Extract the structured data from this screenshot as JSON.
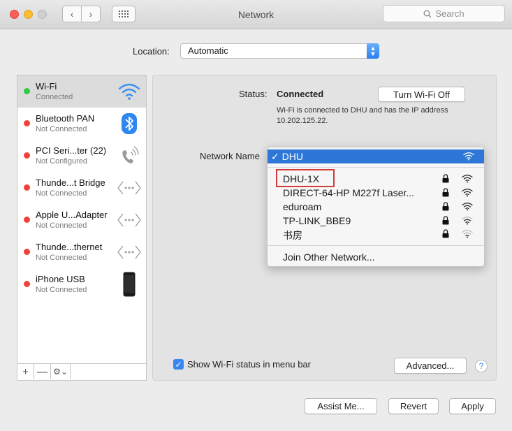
{
  "window": {
    "title": "Network"
  },
  "search": {
    "placeholder": "Search"
  },
  "location": {
    "label": "Location:",
    "value": "Automatic"
  },
  "services": [
    {
      "name": "Wi-Fi",
      "status": "Connected",
      "dot": "#2ecc40",
      "icon": "wifi-icon"
    },
    {
      "name": "Bluetooth PAN",
      "status": "Not Connected",
      "dot": "#f0413a",
      "icon": "bluetooth-icon"
    },
    {
      "name": "PCI Seri...ter (22)",
      "status": "Not Configured",
      "dot": "#f0413a",
      "icon": "phone-icon"
    },
    {
      "name": "Thunde...t Bridge",
      "status": "Not Connected",
      "dot": "#f0413a",
      "icon": "ethernet-icon"
    },
    {
      "name": "Apple U...Adapter",
      "status": "Not Connected",
      "dot": "#f0413a",
      "icon": "ethernet-icon"
    },
    {
      "name": "Thunde...thernet",
      "status": "Not Connected",
      "dot": "#f0413a",
      "icon": "ethernet-icon"
    },
    {
      "name": "iPhone USB",
      "status": "Not Connected",
      "dot": "#f0413a",
      "icon": "iphone-icon"
    }
  ],
  "sidebar_tools": {
    "add": "+",
    "remove": "—",
    "gear": "⚙︎⌄"
  },
  "status": {
    "label": "Status:",
    "value": "Connected",
    "toggle_button": "Turn Wi-Fi Off",
    "description": "Wi-Fi is connected to DHU and has the IP address 10.202.125.22."
  },
  "network_name": {
    "label": "Network Name"
  },
  "dropdown": {
    "selected": "DHU",
    "networks": [
      {
        "name": "DHU-1X"
      },
      {
        "name": "DIRECT-64-HP M227f Laser..."
      },
      {
        "name": "eduroam"
      },
      {
        "name": "TP-LINK_BBE9"
      },
      {
        "name": "书房"
      }
    ],
    "join_other": "Join Other Network..."
  },
  "show_status": {
    "label": "Show Wi-Fi status in menu bar",
    "checked": true
  },
  "buttons": {
    "advanced": "Advanced...",
    "help": "?",
    "assist": "Assist Me...",
    "revert": "Revert",
    "apply": "Apply"
  },
  "colors": {
    "accent": "#2f77d6",
    "highlight_box": "#d33a3a"
  }
}
